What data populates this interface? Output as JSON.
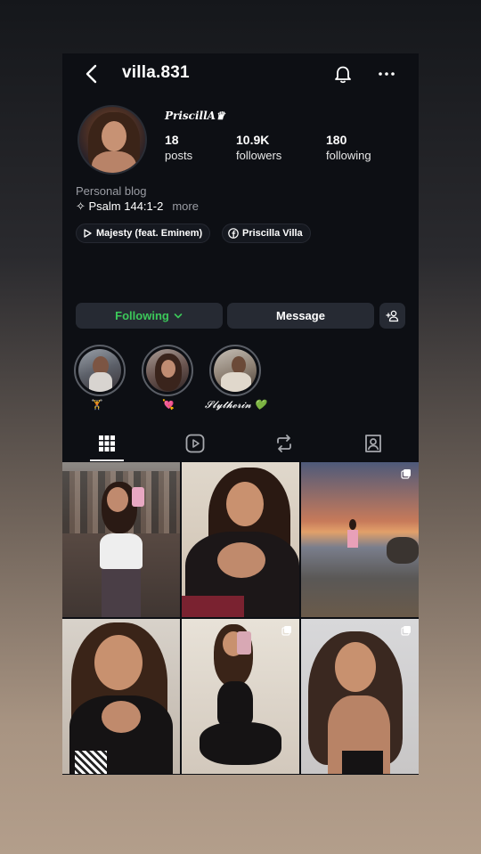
{
  "header": {
    "username": "villa.831"
  },
  "profile": {
    "display_name": "𝑷𝒓𝒊𝒔𝒄𝒊𝒍𝒍𝑨♛",
    "stats": [
      {
        "value": "18",
        "label": "posts"
      },
      {
        "value": "10.9K",
        "label": "followers"
      },
      {
        "value": "180",
        "label": "following"
      }
    ],
    "category": "Personal blog",
    "bio_line": "✧ Psalm 144:1-2",
    "more_label": "more",
    "links": [
      {
        "label": "Majesty (feat. Eminem)",
        "icon": "play-icon"
      },
      {
        "label": "Priscilla Villa",
        "icon": "facebook-icon"
      }
    ]
  },
  "actions": {
    "following_label": "Following",
    "message_label": "Message"
  },
  "highlights": [
    {
      "label": "🏋"
    },
    {
      "label": "💘"
    },
    {
      "label": "𝓢𝓵𝔂𝓽𝓱𝓮𝓻𝓲𝓷 💚"
    }
  ],
  "tabs": [
    {
      "name": "grid",
      "icon": "grid-icon",
      "active": true
    },
    {
      "name": "reels",
      "icon": "reels-icon"
    },
    {
      "name": "reposts",
      "icon": "repost-icon"
    },
    {
      "name": "tagged",
      "icon": "tagged-icon"
    }
  ],
  "colors": {
    "accent_following": "#3cc85a",
    "background": "#0d0f14"
  }
}
